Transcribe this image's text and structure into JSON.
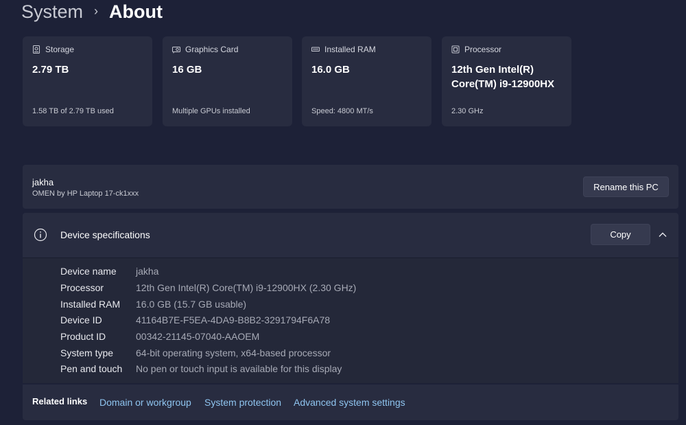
{
  "breadcrumb": {
    "parent": "System",
    "separator": "›",
    "current": "About"
  },
  "cards": [
    {
      "icon": "storage-icon",
      "label": "Storage",
      "value": "2.79 TB",
      "sub": "1.58 TB of 2.79 TB used"
    },
    {
      "icon": "graphics-card-icon",
      "label": "Graphics Card",
      "value": "16 GB",
      "sub": "Multiple GPUs installed"
    },
    {
      "icon": "ram-icon",
      "label": "Installed RAM",
      "value": "16.0 GB",
      "sub": "Speed: 4800 MT/s"
    },
    {
      "icon": "processor-icon",
      "label": "Processor",
      "value_line1": "12th Gen Intel(R)",
      "value_line2": "Core(TM) i9-12900HX",
      "sub": "2.30 GHz"
    }
  ],
  "pc": {
    "name": "jakha",
    "model": "OMEN by HP Laptop 17-ck1xxx",
    "rename_label": "Rename this PC"
  },
  "specs": {
    "title": "Device specifications",
    "copy_label": "Copy",
    "rows": [
      {
        "label": "Device name",
        "value": "jakha"
      },
      {
        "label": "Processor",
        "value": "12th Gen Intel(R) Core(TM) i9-12900HX (2.30 GHz)"
      },
      {
        "label": "Installed RAM",
        "value": "16.0 GB (15.7 GB usable)"
      },
      {
        "label": "Device ID",
        "value": "41164B7E-F5EA-4DA9-B8B2-3291794F6A78"
      },
      {
        "label": "Product ID",
        "value": "00342-21145-07040-AAOEM"
      },
      {
        "label": "System type",
        "value": "64-bit operating system, x64-based processor"
      },
      {
        "label": "Pen and touch",
        "value": "No pen or touch input is available for this display"
      }
    ]
  },
  "related": {
    "label": "Related links",
    "links": [
      "Domain or workgroup",
      "System protection",
      "Advanced system settings"
    ]
  },
  "colors": {
    "background": "#1d2137",
    "card": "#282c40",
    "link": "#8fc5f0"
  }
}
